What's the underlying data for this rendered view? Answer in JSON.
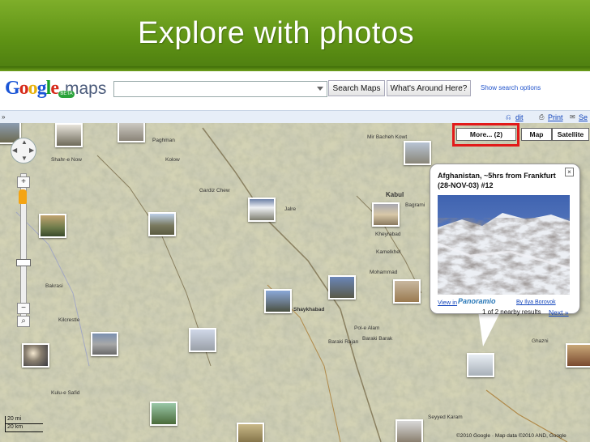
{
  "slide": {
    "title": "Explore with photos"
  },
  "header": {
    "logo_text": "Google",
    "logo_maps": "maps",
    "beta": "BETA",
    "search_value": "",
    "search_button": "Search Maps",
    "around_button": "What's Around Here?",
    "show_options": "Show search options"
  },
  "strip": {
    "left_icon": "»",
    "links": [
      "dit",
      "Print",
      "Se"
    ]
  },
  "maptype": {
    "more": "More... (2)",
    "map": "Map",
    "satellite": "Satellite"
  },
  "controls": {
    "zoom_in": "+",
    "zoom_out": "−"
  },
  "bubble": {
    "title": "Afghanistan, ~5hrs from Frankfurt (28-NOV-03) #12",
    "view_in": "View in",
    "panoramio": "Panoramio",
    "by": "By Ilya Borovok",
    "count": "1 of 2 nearby results",
    "next": "Next »",
    "close": "×"
  },
  "labels": {
    "l1": "Shahr-e Now",
    "l2": "Kabul",
    "l3": "Bagrami",
    "l4": "Jalre",
    "l5": "Pol-e Alam",
    "l6": "Baraki Barak",
    "l7": "Kulu-e Safid",
    "l8": "Kheyrabad",
    "l9": "Shaykhabad",
    "l10": "Mohammad",
    "l11": "Seyyed Karam",
    "l12": "Ghazni",
    "l13": "Mir Bacheh Kowt",
    "l14": "Kolow",
    "l15": "Gardiz Chew",
    "l16": "Paghman",
    "l17": "Baraki Rajan",
    "l18": "Kilcrestle",
    "l19": "Kamelkhel",
    "l20": "Bakrasi"
  },
  "scale": {
    "metric": "20 mi",
    "imperial": "20 km"
  },
  "copyright": "©2010 Google · Map data ©2010 AND, Google"
}
